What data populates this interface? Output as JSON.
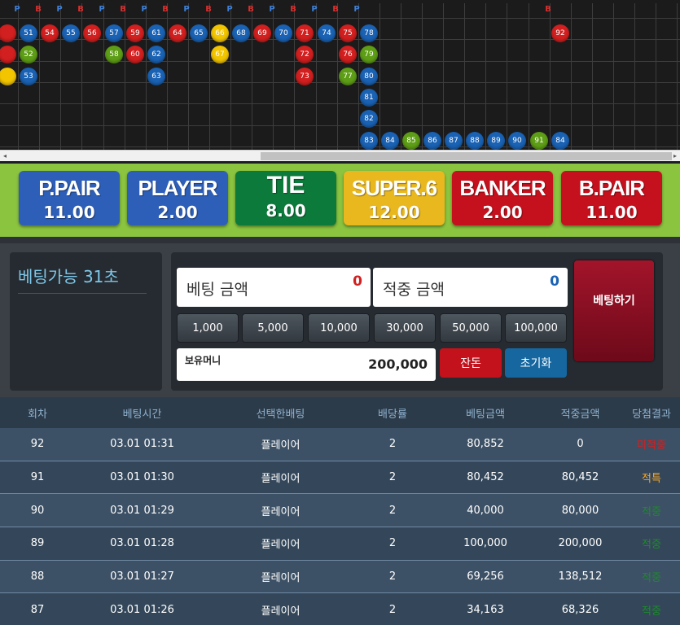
{
  "road": {
    "header": [
      "P",
      "B",
      "P",
      "B",
      "P",
      "B",
      "P",
      "B",
      "P",
      "B",
      "P",
      "B",
      "P",
      "B",
      "P",
      "B",
      "P",
      "",
      "",
      "",
      "",
      "",
      "",
      "",
      "",
      "B"
    ],
    "balls": [
      {
        "c": 0,
        "r": 0,
        "n": "",
        "color": "red"
      },
      {
        "c": 1,
        "r": 0,
        "n": "51",
        "color": "blue"
      },
      {
        "c": 2,
        "r": 0,
        "n": "54",
        "color": "red"
      },
      {
        "c": 3,
        "r": 0,
        "n": "55",
        "color": "blue"
      },
      {
        "c": 4,
        "r": 0,
        "n": "56",
        "color": "red"
      },
      {
        "c": 5,
        "r": 0,
        "n": "57",
        "color": "blue"
      },
      {
        "c": 6,
        "r": 0,
        "n": "59",
        "color": "red"
      },
      {
        "c": 7,
        "r": 0,
        "n": "61",
        "color": "blue"
      },
      {
        "c": 8,
        "r": 0,
        "n": "64",
        "color": "red"
      },
      {
        "c": 9,
        "r": 0,
        "n": "65",
        "color": "blue"
      },
      {
        "c": 10,
        "r": 0,
        "n": "66",
        "color": "yellow"
      },
      {
        "c": 11,
        "r": 0,
        "n": "68",
        "color": "blue"
      },
      {
        "c": 12,
        "r": 0,
        "n": "69",
        "color": "red"
      },
      {
        "c": 13,
        "r": 0,
        "n": "70",
        "color": "blue"
      },
      {
        "c": 14,
        "r": 0,
        "n": "71",
        "color": "red"
      },
      {
        "c": 15,
        "r": 0,
        "n": "74",
        "color": "blue"
      },
      {
        "c": 16,
        "r": 0,
        "n": "75",
        "color": "red"
      },
      {
        "c": 17,
        "r": 0,
        "n": "78",
        "color": "blue"
      },
      {
        "c": 26,
        "r": 0,
        "n": "92",
        "color": "red"
      },
      {
        "c": 0,
        "r": 1,
        "n": "",
        "color": "red"
      },
      {
        "c": 1,
        "r": 1,
        "n": "52",
        "color": "green"
      },
      {
        "c": 5,
        "r": 1,
        "n": "58",
        "color": "green"
      },
      {
        "c": 6,
        "r": 1,
        "n": "60",
        "color": "red"
      },
      {
        "c": 7,
        "r": 1,
        "n": "62",
        "color": "blue"
      },
      {
        "c": 10,
        "r": 1,
        "n": "67",
        "color": "yellow"
      },
      {
        "c": 14,
        "r": 1,
        "n": "72",
        "color": "red"
      },
      {
        "c": 16,
        "r": 1,
        "n": "76",
        "color": "red"
      },
      {
        "c": 17,
        "r": 1,
        "n": "79",
        "color": "green"
      },
      {
        "c": 0,
        "r": 2,
        "n": "",
        "color": "yellow"
      },
      {
        "c": 1,
        "r": 2,
        "n": "53",
        "color": "blue"
      },
      {
        "c": 7,
        "r": 2,
        "n": "63",
        "color": "blue"
      },
      {
        "c": 14,
        "r": 2,
        "n": "73",
        "color": "red"
      },
      {
        "c": 16,
        "r": 2,
        "n": "77",
        "color": "green"
      },
      {
        "c": 17,
        "r": 2,
        "n": "80",
        "color": "blue"
      },
      {
        "c": 17,
        "r": 3,
        "n": "81",
        "color": "blue"
      },
      {
        "c": 17,
        "r": 4,
        "n": "82",
        "color": "blue"
      },
      {
        "c": 17,
        "r": 5,
        "n": "83",
        "color": "blue"
      },
      {
        "c": 18,
        "r": 5,
        "n": "84",
        "color": "blue"
      },
      {
        "c": 19,
        "r": 5,
        "n": "85",
        "color": "green"
      },
      {
        "c": 20,
        "r": 5,
        "n": "86",
        "color": "blue"
      },
      {
        "c": 21,
        "r": 5,
        "n": "87",
        "color": "blue"
      },
      {
        "c": 22,
        "r": 5,
        "n": "88",
        "color": "blue"
      },
      {
        "c": 23,
        "r": 5,
        "n": "89",
        "color": "blue"
      },
      {
        "c": 24,
        "r": 5,
        "n": "90",
        "color": "blue"
      },
      {
        "c": 25,
        "r": 5,
        "n": "91",
        "color": "green"
      },
      {
        "c": 26,
        "r": 5,
        "n": "84",
        "color": "blue"
      }
    ],
    "colors": {
      "red": "#d21f1f",
      "blue": "#1a62b4",
      "green": "#5e9e16",
      "yellow": "#f2c500",
      "player_text": "#3f7fd6",
      "banker_text": "#d8302e"
    }
  },
  "scroll": {
    "left": "◂",
    "right": "▸"
  },
  "bets": [
    {
      "name": "P.PAIR",
      "odds": "11.00",
      "color": "#2e5fb8"
    },
    {
      "name": "PLAYER",
      "odds": "2.00",
      "color": "#2e5fb8"
    },
    {
      "name": "TIE",
      "odds": "8.00",
      "color": "#0c7a3b"
    },
    {
      "name": "SUPER.6",
      "odds": "12.00",
      "color": "#e9b81e"
    },
    {
      "name": "BANKER",
      "odds": "2.00",
      "color": "#c5101d"
    },
    {
      "name": "B.PAIR",
      "odds": "11.00",
      "color": "#c5101d"
    }
  ],
  "panel": {
    "countdown": "베팅가능 31초",
    "bet_amount_label": "베팅 금액",
    "bet_amount_value": "0",
    "win_amount_label": "적중 금액",
    "win_amount_value": "0",
    "chips": [
      "1,000",
      "5,000",
      "10,000",
      "30,000",
      "50,000",
      "100,000"
    ],
    "balance_label": "보유머니",
    "balance_value": "200,000",
    "balance_button": "잔돈",
    "reset_button": "초기화",
    "bet_button": "베팅하기"
  },
  "history": {
    "columns": [
      "회차",
      "베팅시간",
      "선택한배팅",
      "배당률",
      "베팅금액",
      "적중금액",
      "당첨결과"
    ],
    "rows": [
      {
        "round": "92",
        "time": "03.01 01:31",
        "pick": "플레이어",
        "odds": "2",
        "bet": "80,852",
        "win": "0",
        "result": "미적중",
        "result_color": "red"
      },
      {
        "round": "91",
        "time": "03.01 01:30",
        "pick": "플레이어",
        "odds": "2",
        "bet": "80,452",
        "win": "80,452",
        "result": "적특",
        "result_color": "gold"
      },
      {
        "round": "90",
        "time": "03.01 01:29",
        "pick": "플레이어",
        "odds": "2",
        "bet": "40,000",
        "win": "80,000",
        "result": "적중",
        "result_color": "green"
      },
      {
        "round": "89",
        "time": "03.01 01:28",
        "pick": "플레이어",
        "odds": "2",
        "bet": "100,000",
        "win": "200,000",
        "result": "적중",
        "result_color": "green"
      },
      {
        "round": "88",
        "time": "03.01 01:27",
        "pick": "플레이어",
        "odds": "2",
        "bet": "69,256",
        "win": "138,512",
        "result": "적중",
        "result_color": "green"
      },
      {
        "round": "87",
        "time": "03.01 01:26",
        "pick": "플레이어",
        "odds": "2",
        "bet": "34,163",
        "win": "68,326",
        "result": "적중",
        "result_color": "green"
      }
    ]
  }
}
